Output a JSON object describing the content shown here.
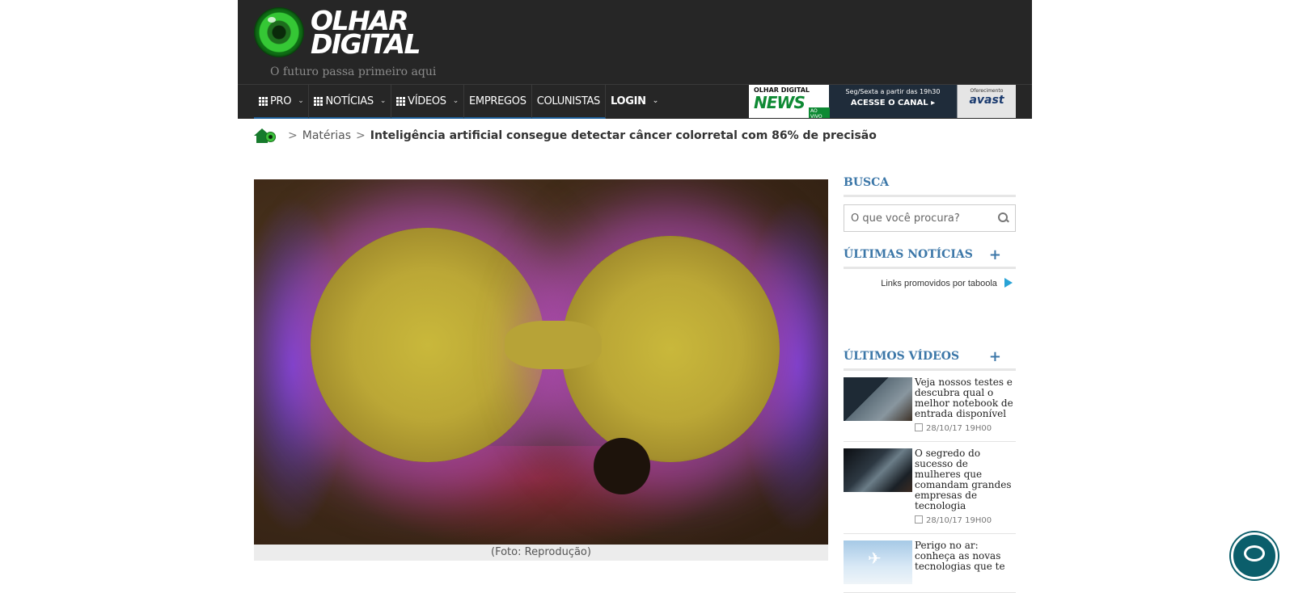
{
  "header": {
    "logo_line1": "OLHAR",
    "logo_line2": "DIGITAL",
    "tagline": "O futuro passa primeiro aqui",
    "nav": [
      {
        "label": "PRO",
        "has_grid_icon": true,
        "has_dropdown": true
      },
      {
        "label": "NOTÍCIAS",
        "has_grid_icon": true,
        "has_dropdown": true
      },
      {
        "label": "VÍDEOS",
        "has_grid_icon": true,
        "has_dropdown": true
      },
      {
        "label": "EMPREGOS"
      },
      {
        "label": "COLUNISTAS"
      },
      {
        "label": "LOGIN",
        "has_dropdown": true
      }
    ],
    "banner": {
      "brand_small": "OLHAR DIGITAL",
      "brand_big": "NEWS",
      "live_badge": "AO VIVO",
      "schedule": "Seg/Sexta a partir das 19h30",
      "cta": "ACESSE O CANAL ▸",
      "sponsor_label": "Oferecimento",
      "sponsor": "avast"
    }
  },
  "breadcrumb": {
    "items": [
      "Matérias"
    ],
    "current": "Inteligência artificial consegue detectar câncer colorretal com 86% de precisão"
  },
  "article": {
    "image_caption": "(Foto: Reprodução)"
  },
  "sidebar": {
    "search_title": "BUSCA",
    "search_placeholder": "O que você procura?",
    "latest_news_title": "ÚLTIMAS NOTÍCIAS",
    "promoted_label": "Links promovidos por taboola",
    "latest_videos_title": "ÚLTIMOS VÍDEOS",
    "videos": [
      {
        "title": "Veja nossos testes e descubra qual o melhor notebook de entrada disponível",
        "date": "28/10/17 19H00"
      },
      {
        "title": "O segredo do sucesso de mulheres que comandam grandes empresas de tecnologia",
        "date": "28/10/17 19H00"
      },
      {
        "title": "Perigo no ar: conheça as novas tecnologias que te",
        "date": ""
      }
    ]
  },
  "colors": {
    "header_bg": "#262626",
    "accent_blue": "#3c77a8",
    "brand_green": "#167a2c",
    "chat_button": "#0b5e6b"
  }
}
